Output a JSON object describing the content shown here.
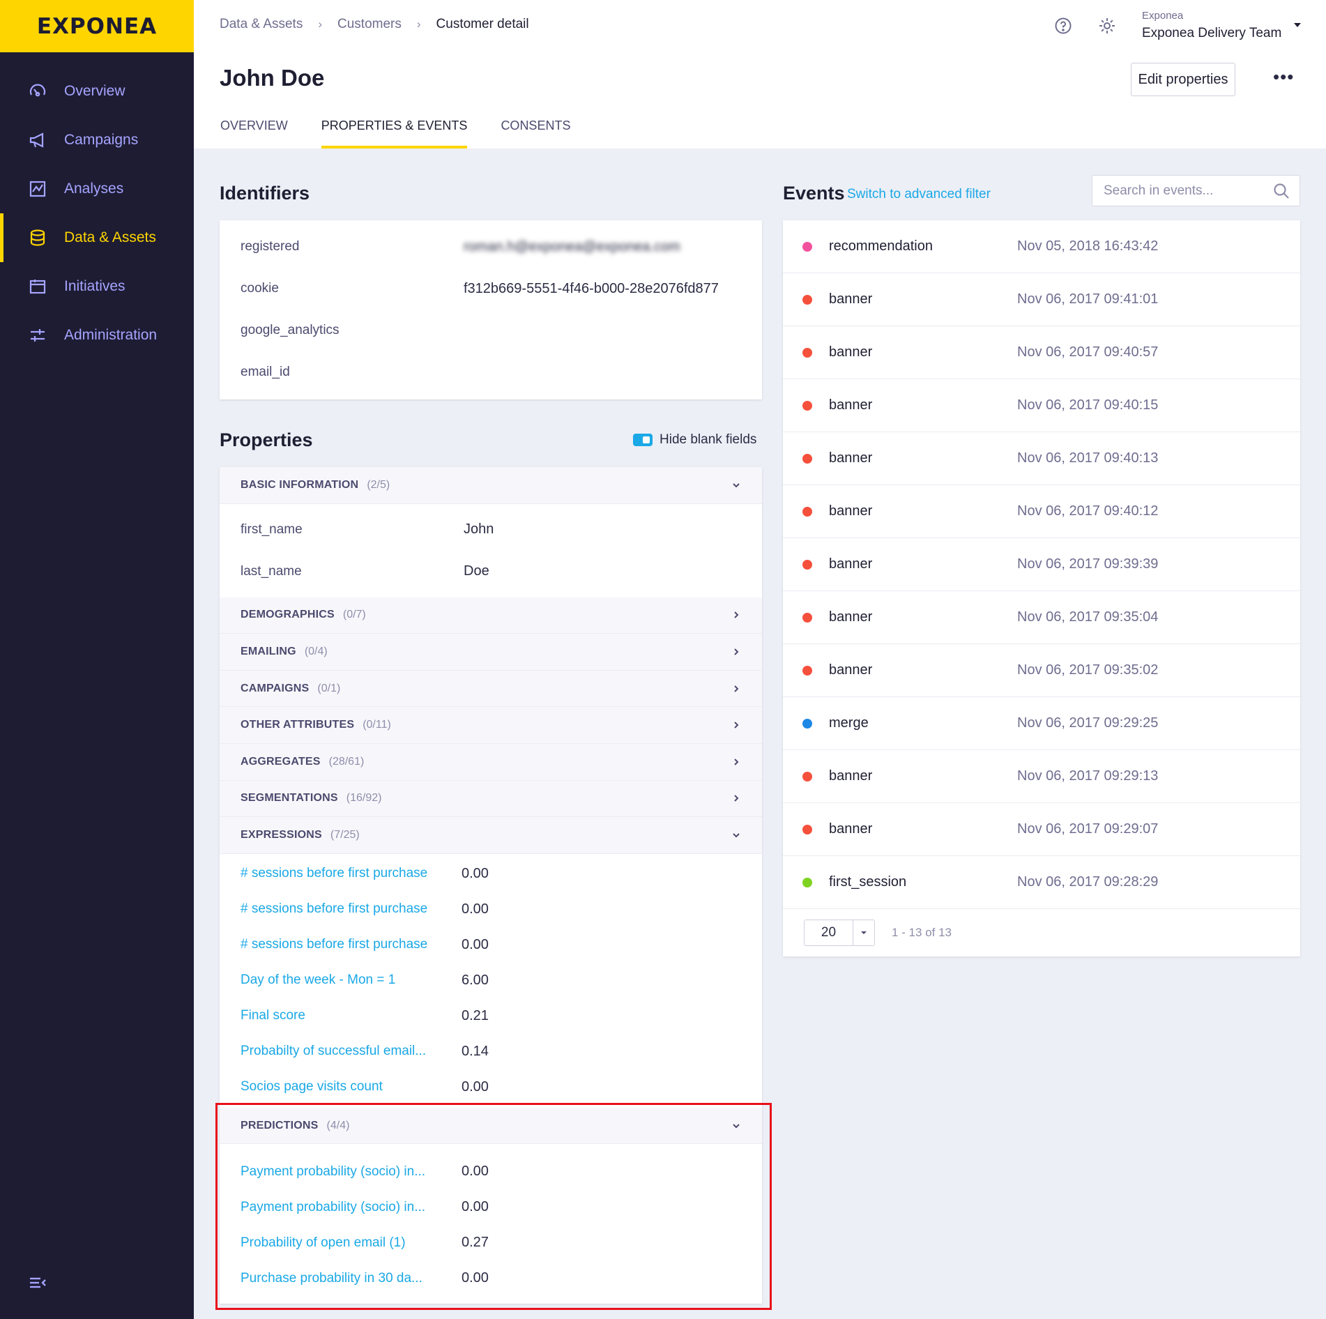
{
  "brand": {
    "logo": "EXPONEA",
    "accent": "#ffd500",
    "sidebar_bg": "#1d1c33",
    "link": "#1aa8e6"
  },
  "sidebar": {
    "items": [
      {
        "label": "Overview",
        "icon": "dashboard-gauge-icon",
        "active": false
      },
      {
        "label": "Campaigns",
        "icon": "megaphone-icon",
        "active": false
      },
      {
        "label": "Analyses",
        "icon": "chart-icon",
        "active": false
      },
      {
        "label": "Data & Assets",
        "icon": "database-icon",
        "active": true
      },
      {
        "label": "Initiatives",
        "icon": "folder-icon",
        "active": false
      },
      {
        "label": "Administration",
        "icon": "sliders-icon",
        "active": false
      }
    ],
    "collapse_icon": "collapse-menu-icon"
  },
  "header": {
    "breadcrumb": [
      "Data & Assets",
      "Customers",
      "Customer detail"
    ],
    "title": "John Doe",
    "account_org": "Exponea",
    "account_name": "Exponea Delivery Team",
    "edit_button": "Edit properties",
    "more": "•••",
    "tabs": [
      {
        "label": "OVERVIEW",
        "active": false
      },
      {
        "label": "PROPERTIES & EVENTS",
        "active": true
      },
      {
        "label": "CONSENTS",
        "active": false
      }
    ]
  },
  "identifiers": {
    "title": "Identifiers",
    "rows": [
      {
        "key": "registered",
        "value": "roman.h@exponea@exponea.com"
      },
      {
        "key": "cookie",
        "value": "f312b669-5551-4f46-b000-28e2076fd877"
      },
      {
        "key": "google_analytics",
        "value": ""
      },
      {
        "key": "email_id",
        "value": ""
      }
    ]
  },
  "properties": {
    "title": "Properties",
    "hide_blank_label": "Hide blank fields",
    "basic": {
      "name": "BASIC INFORMATION",
      "count": "(2/5)"
    },
    "basic_rows": [
      {
        "key": "first_name",
        "value": "John"
      },
      {
        "key": "last_name",
        "value": "Doe"
      }
    ],
    "groups": [
      {
        "name": "DEMOGRAPHICS",
        "count": "(0/7)"
      },
      {
        "name": "EMAILING",
        "count": "(0/4)"
      },
      {
        "name": "CAMPAIGNS",
        "count": "(0/1)"
      },
      {
        "name": "OTHER ATTRIBUTES",
        "count": "(0/11)"
      },
      {
        "name": "AGGREGATES",
        "count": "(28/61)"
      },
      {
        "name": "SEGMENTATIONS",
        "count": "(16/92)"
      }
    ],
    "expressions": {
      "name": "EXPRESSIONS",
      "count": "(7/25)"
    },
    "expression_rows": [
      {
        "key": "# sessions before first purchase",
        "value": "0.00"
      },
      {
        "key": "# sessions before first purchase",
        "value": "0.00"
      },
      {
        "key": "# sessions before first purchase",
        "value": "0.00"
      },
      {
        "key": "Day of the week - Mon = 1",
        "value": "6.00"
      },
      {
        "key": "Final score",
        "value": "0.21"
      },
      {
        "key": "Probabilty of successful email...",
        "value": "0.14"
      },
      {
        "key": "Socios page visits count",
        "value": "0.00"
      }
    ],
    "predictions": {
      "name": "PREDICTIONS",
      "count": "(4/4)"
    },
    "prediction_rows": [
      {
        "key": "Payment probability (socio) in...",
        "value": "0.00"
      },
      {
        "key": "Payment probability (socio) in...",
        "value": "0.00"
      },
      {
        "key": "Probability of open email (1)",
        "value": "0.27"
      },
      {
        "key": "Purchase probability in 30 da...",
        "value": "0.00"
      }
    ]
  },
  "events": {
    "title": "Events",
    "advanced_filter": "Switch to advanced filter",
    "search_placeholder": "Search in events...",
    "rows": [
      {
        "name": "recommendation",
        "time": "Nov 05, 2018 16:43:42",
        "color": "#f2529d"
      },
      {
        "name": "banner",
        "time": "Nov 06, 2017 09:41:01",
        "color": "#f5503c"
      },
      {
        "name": "banner",
        "time": "Nov 06, 2017 09:40:57",
        "color": "#f5503c"
      },
      {
        "name": "banner",
        "time": "Nov 06, 2017 09:40:15",
        "color": "#f5503c"
      },
      {
        "name": "banner",
        "time": "Nov 06, 2017 09:40:13",
        "color": "#f5503c"
      },
      {
        "name": "banner",
        "time": "Nov 06, 2017 09:40:12",
        "color": "#f5503c"
      },
      {
        "name": "banner",
        "time": "Nov 06, 2017 09:39:39",
        "color": "#f5503c"
      },
      {
        "name": "banner",
        "time": "Nov 06, 2017 09:35:04",
        "color": "#f5503c"
      },
      {
        "name": "banner",
        "time": "Nov 06, 2017 09:35:02",
        "color": "#f5503c"
      },
      {
        "name": "merge",
        "time": "Nov 06, 2017 09:29:25",
        "color": "#1e88e5"
      },
      {
        "name": "banner",
        "time": "Nov 06, 2017 09:29:13",
        "color": "#f5503c"
      },
      {
        "name": "banner",
        "time": "Nov 06, 2017 09:29:07",
        "color": "#f5503c"
      },
      {
        "name": "first_session",
        "time": "Nov 06, 2017 09:28:29",
        "color": "#7ed321"
      }
    ],
    "page_size": "20",
    "page_info": "1 - 13 of 13"
  }
}
